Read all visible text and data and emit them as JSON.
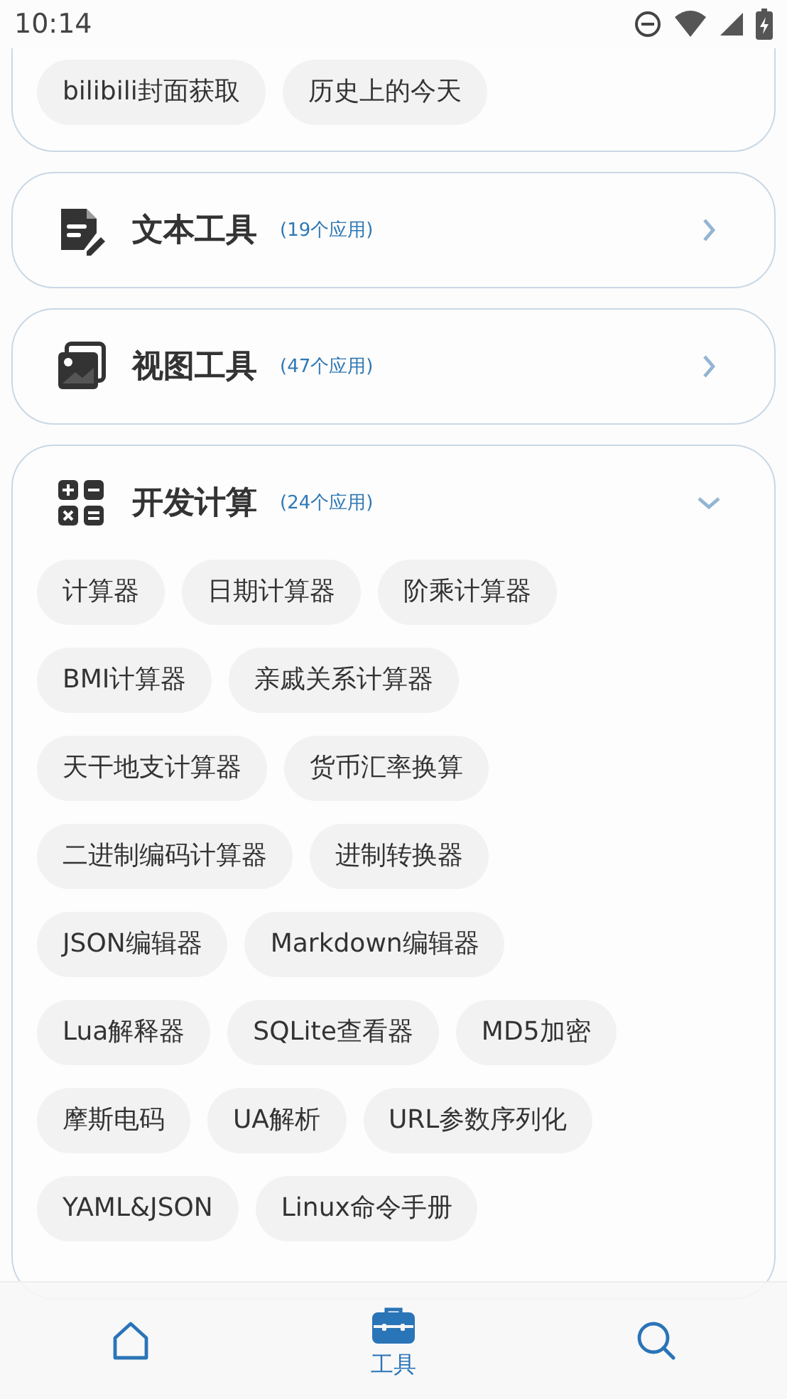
{
  "status_bar": {
    "time": "10:14"
  },
  "previous_section": {
    "tools": [
      "bilibili封面获取",
      "历史上的今天"
    ]
  },
  "categories": [
    {
      "kind": "text",
      "title": "文本工具",
      "count": "(19个应用)",
      "expanded": false
    },
    {
      "kind": "image",
      "title": "视图工具",
      "count": "(47个应用)",
      "expanded": false
    },
    {
      "kind": "calc",
      "title": "开发计算",
      "count": "(24个应用)",
      "expanded": true,
      "tool_rows": [
        [
          "计算器",
          "日期计算器",
          "阶乘计算器"
        ],
        [
          "BMI计算器",
          "亲戚关系计算器"
        ],
        [
          "天干地支计算器",
          "货币汇率换算"
        ],
        [
          "二进制编码计算器",
          "进制转换器"
        ],
        [
          "JSON编辑器",
          "Markdown编辑器"
        ],
        [
          "Lua解释器",
          "SQLite查看器",
          "MD5加密"
        ],
        [
          "摩斯电码",
          "UA解析",
          "URL参数序列化"
        ],
        [
          "YAML&JSON",
          "Linux命令手册"
        ]
      ]
    }
  ],
  "bottom_nav": [
    {
      "kind": "home",
      "selected": false
    },
    {
      "kind": "toolbox",
      "label": "工具",
      "selected": true
    },
    {
      "kind": "search",
      "selected": false
    }
  ]
}
